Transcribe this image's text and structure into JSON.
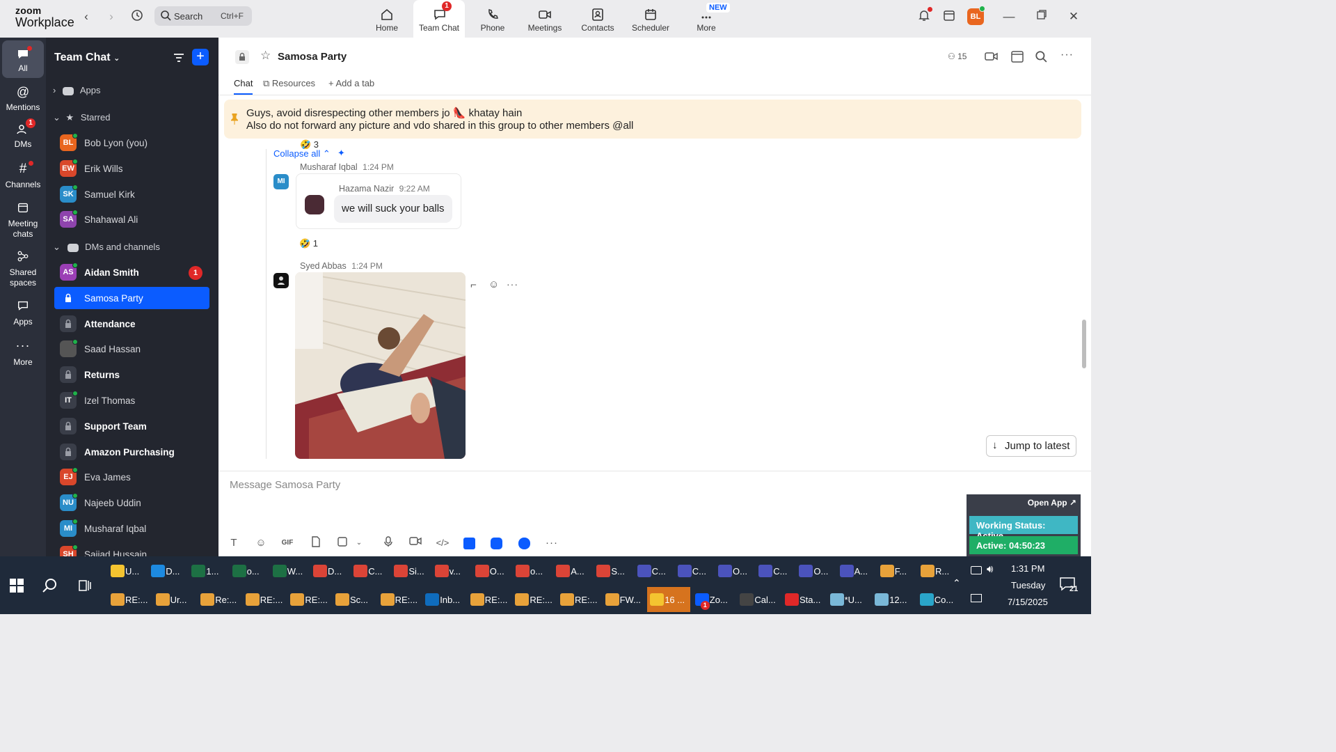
{
  "window": {
    "logo_line1": "zoom",
    "logo_line2": "Workplace",
    "search": {
      "label": "Search",
      "shortcut": "Ctrl+F"
    },
    "nav_tabs": [
      {
        "label": "Home",
        "icon": "home-icon"
      },
      {
        "label": "Team Chat",
        "icon": "team-chat-icon",
        "badge": "1",
        "active": true
      },
      {
        "label": "Phone",
        "icon": "phone-icon"
      },
      {
        "label": "Meetings",
        "icon": "video-icon"
      },
      {
        "label": "Contacts",
        "icon": "contacts-icon"
      },
      {
        "label": "Scheduler",
        "icon": "scheduler-icon"
      },
      {
        "label": "More",
        "icon": "more-icon",
        "tag": "NEW"
      }
    ],
    "user_initials": "BL",
    "brand_color": "#0b5cff"
  },
  "rail": [
    {
      "label": "All",
      "active": true
    },
    {
      "label": "Mentions"
    },
    {
      "label": "DMs",
      "badge": "1"
    },
    {
      "label": "Channels"
    },
    {
      "label": "Meeting chats"
    },
    {
      "label": "Shared spaces"
    },
    {
      "label": "Apps"
    },
    {
      "label": "More"
    }
  ],
  "sidebar": {
    "title": "Team Chat",
    "section_apps": "Apps",
    "section_starred": "Starred",
    "starred": [
      {
        "name": "Bob Lyon (you)",
        "initials": "BL",
        "color": "#e9661f"
      },
      {
        "name": "Erik Wills",
        "initials": "EW",
        "color": "#d9472b"
      },
      {
        "name": "Samuel Kirk",
        "initials": "SK",
        "color": "#2a8dc9"
      },
      {
        "name": "Shahawal Ali",
        "initials": "SA",
        "color": "#8e44ad"
      }
    ],
    "section_dms": "DMs and channels",
    "dms": [
      {
        "name": "Aidan Smith",
        "initials": "AS",
        "color": "#9b3fb5",
        "bold": true,
        "badge": "1"
      },
      {
        "name": "Samosa Party",
        "type": "channel",
        "selected": true
      },
      {
        "name": "Attendance",
        "type": "channel",
        "bold": true
      },
      {
        "name": "Saad Hassan",
        "initials": "",
        "color": "#555",
        "photo": true
      },
      {
        "name": "Returns",
        "type": "channel",
        "bold": true
      },
      {
        "name": "Izel Thomas",
        "initials": "IT",
        "color": "#3a3e49"
      },
      {
        "name": "Support Team",
        "type": "channel",
        "bold": true
      },
      {
        "name": "Amazon Purchasing",
        "type": "channel",
        "bold": true
      },
      {
        "name": "Eva James",
        "initials": "EJ",
        "color": "#d9472b"
      },
      {
        "name": "Najeeb Uddin",
        "initials": "NU",
        "color": "#2a8dc9"
      },
      {
        "name": "Musharaf Iqbal",
        "initials": "MI",
        "color": "#2a8dc9"
      },
      {
        "name": "Sajjad Hussain",
        "initials": "SH",
        "color": "#d9472b"
      }
    ]
  },
  "channel": {
    "name": "Samosa Party",
    "member_count": "15",
    "tabs": [
      "Chat",
      "Resources",
      "Add a tab"
    ],
    "pinned_line1": "Guys, avoid disrespecting other members jo 👠 khatay hain",
    "pinned_line2": "Also do not forward any picture and vdo shared in this group to other members @all",
    "reaction_top": "🤣 3",
    "collapse_label": "Collapse all ⌃",
    "messages": [
      {
        "sender": "Musharaf Iqbal",
        "time": "1:24 PM",
        "initials": "MI",
        "quoted_sender": "Hazama Nazir",
        "quoted_time": "9:22 AM",
        "quoted_text": "we will suck your balls",
        "reaction": "🤣 1"
      },
      {
        "sender": "Syed Abbas",
        "time": "1:24 PM",
        "attachment": "photo"
      }
    ],
    "jump_label": "Jump to latest",
    "composer_placeholder": "Message Samosa Party"
  },
  "widget": {
    "open_app": "Open App ↗",
    "status": "Working Status: Active",
    "active_timer": "Active: 04:50:23"
  },
  "taskbar": {
    "row1": [
      {
        "label": "U...",
        "color": "#f4c430"
      },
      {
        "label": "D...",
        "color": "#1d8ae0"
      },
      {
        "label": "1...",
        "color": "#1d7044"
      },
      {
        "label": "o...",
        "color": "#1d7044"
      },
      {
        "label": "W...",
        "color": "#1d7044"
      },
      {
        "label": "D...",
        "color": "#db4437"
      },
      {
        "label": "C...",
        "color": "#db4437"
      },
      {
        "label": "Si...",
        "color": "#db4437"
      },
      {
        "label": "v...",
        "color": "#db4437"
      },
      {
        "label": "O...",
        "color": "#db4437"
      },
      {
        "label": "o...",
        "color": "#db4437"
      },
      {
        "label": "A...",
        "color": "#db4437"
      },
      {
        "label": "S...",
        "color": "#db4437"
      },
      {
        "label": "C...",
        "color": "#4b53bc"
      },
      {
        "label": "C...",
        "color": "#4b53bc"
      },
      {
        "label": "O...",
        "color": "#4b53bc"
      },
      {
        "label": "C...",
        "color": "#4b53bc"
      },
      {
        "label": "O...",
        "color": "#4b53bc"
      },
      {
        "label": "A...",
        "color": "#4b53bc"
      },
      {
        "label": "F...",
        "color": "#e8a23a"
      },
      {
        "label": "R...",
        "color": "#e8a23a"
      }
    ],
    "row2": [
      {
        "label": "RE:...",
        "color": "#e8a23a"
      },
      {
        "label": "Ur...",
        "color": "#e8a23a"
      },
      {
        "label": "Re:...",
        "color": "#e8a23a"
      },
      {
        "label": "RE:...",
        "color": "#e8a23a"
      },
      {
        "label": "RE:...",
        "color": "#e8a23a"
      },
      {
        "label": "Sc...",
        "color": "#e8a23a"
      },
      {
        "label": "RE:...",
        "color": "#e8a23a"
      },
      {
        "label": "Inb...",
        "color": "#0f6cbd"
      },
      {
        "label": "RE:...",
        "color": "#e8a23a"
      },
      {
        "label": "RE:...",
        "color": "#e8a23a"
      },
      {
        "label": "RE:...",
        "color": "#e8a23a"
      },
      {
        "label": "FW...",
        "color": "#e8a23a"
      },
      {
        "label": "16 ...",
        "color": "#f4c430",
        "highlight": true
      },
      {
        "label": "Zo...",
        "color": "#0b5cff",
        "badge": "1"
      },
      {
        "label": "Cal...",
        "color": "#444"
      },
      {
        "label": "Sta...",
        "color": "#e02828"
      },
      {
        "label": "*U...",
        "color": "#7ab8d8"
      },
      {
        "label": "12...",
        "color": "#7ab8d8"
      },
      {
        "label": "Co...",
        "color": "#2aa5c9"
      }
    ],
    "time": "1:31 PM",
    "day": "Tuesday",
    "date": "7/15/2025",
    "notifications": "21"
  }
}
